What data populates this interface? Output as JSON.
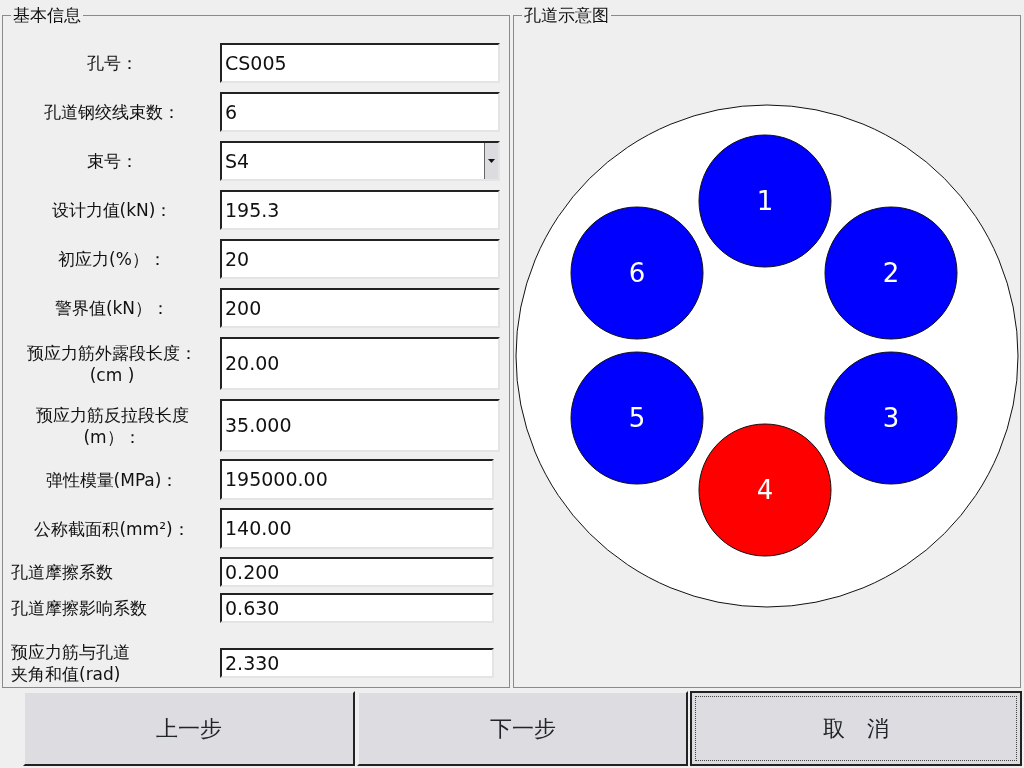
{
  "basic_info": {
    "title": "基本信息",
    "fields": [
      {
        "label": "孔号：",
        "value": "CS005",
        "kind": "text"
      },
      {
        "label": "孔道钢绞线束数：",
        "value": "6",
        "kind": "text"
      },
      {
        "label": "束号：",
        "value": "S4",
        "kind": "select"
      },
      {
        "label": "设计力值(kN)：",
        "value": "195.3",
        "kind": "text"
      },
      {
        "label": "初应力(%）：",
        "value": "20",
        "kind": "text"
      },
      {
        "label": "警界值(kN）：",
        "value": "200",
        "kind": "text"
      },
      {
        "label": "预应力筋外露段长度：(cm )",
        "value": "20.00",
        "kind": "text"
      },
      {
        "label": "预应力筋反拉段长度(m）：",
        "value": "35.000",
        "kind": "text"
      },
      {
        "label": "弹性模量(MPa)：",
        "value": "195000.00",
        "kind": "text"
      },
      {
        "label": "公称截面积(mm²)：",
        "value": "140.00",
        "kind": "text"
      },
      {
        "label": "孔道摩擦系数",
        "value": "0.200",
        "kind": "text"
      },
      {
        "label": "孔道摩擦影响系数",
        "value": "0.630",
        "kind": "text"
      },
      {
        "label": "预应力筋与孔道夹角和值(rad)",
        "value": "2.330",
        "kind": "text"
      }
    ]
  },
  "diagram": {
    "title": "孔道示意图",
    "strands": [
      {
        "label": "1",
        "color": "#0000ff"
      },
      {
        "label": "2",
        "color": "#0000ff"
      },
      {
        "label": "3",
        "color": "#0000ff"
      },
      {
        "label": "4",
        "color": "#ff0000"
      },
      {
        "label": "5",
        "color": "#0000ff"
      },
      {
        "label": "6",
        "color": "#0000ff"
      }
    ]
  },
  "buttons": [
    {
      "label": "上一步",
      "focused": false
    },
    {
      "label": "下一步",
      "focused": false
    },
    {
      "label": "取　消",
      "focused": true
    }
  ]
}
